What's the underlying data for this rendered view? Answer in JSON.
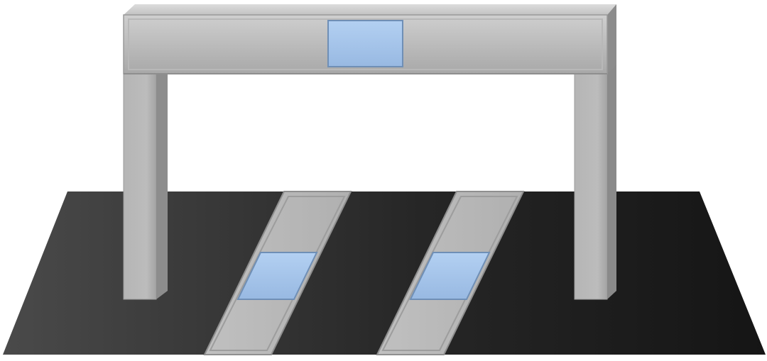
{
  "scene": {
    "colors": {
      "background": "#ffffff",
      "road_light": "#4a4a4a",
      "road_dark": "#151515",
      "gantry_light": "#c4c4c4",
      "gantry_mid": "#acacac",
      "gantry_shadow": "#8a8a8a",
      "gantry_edge": "#9a9a9a",
      "plate_light": "#b9b9b9",
      "plate_edge": "#8f8f8f",
      "sensor_blue": "#a6c6ec",
      "sensor_blue_edge": "#6f8fb6"
    },
    "objects": [
      {
        "name": "road-surface",
        "kind": "ground"
      },
      {
        "name": "gantry-frame",
        "kind": "overhead-structure",
        "panels": 1
      },
      {
        "name": "ground-plate-left",
        "kind": "ground-plate",
        "panels": 1
      },
      {
        "name": "ground-plate-right",
        "kind": "ground-plate",
        "panels": 1
      }
    ]
  }
}
